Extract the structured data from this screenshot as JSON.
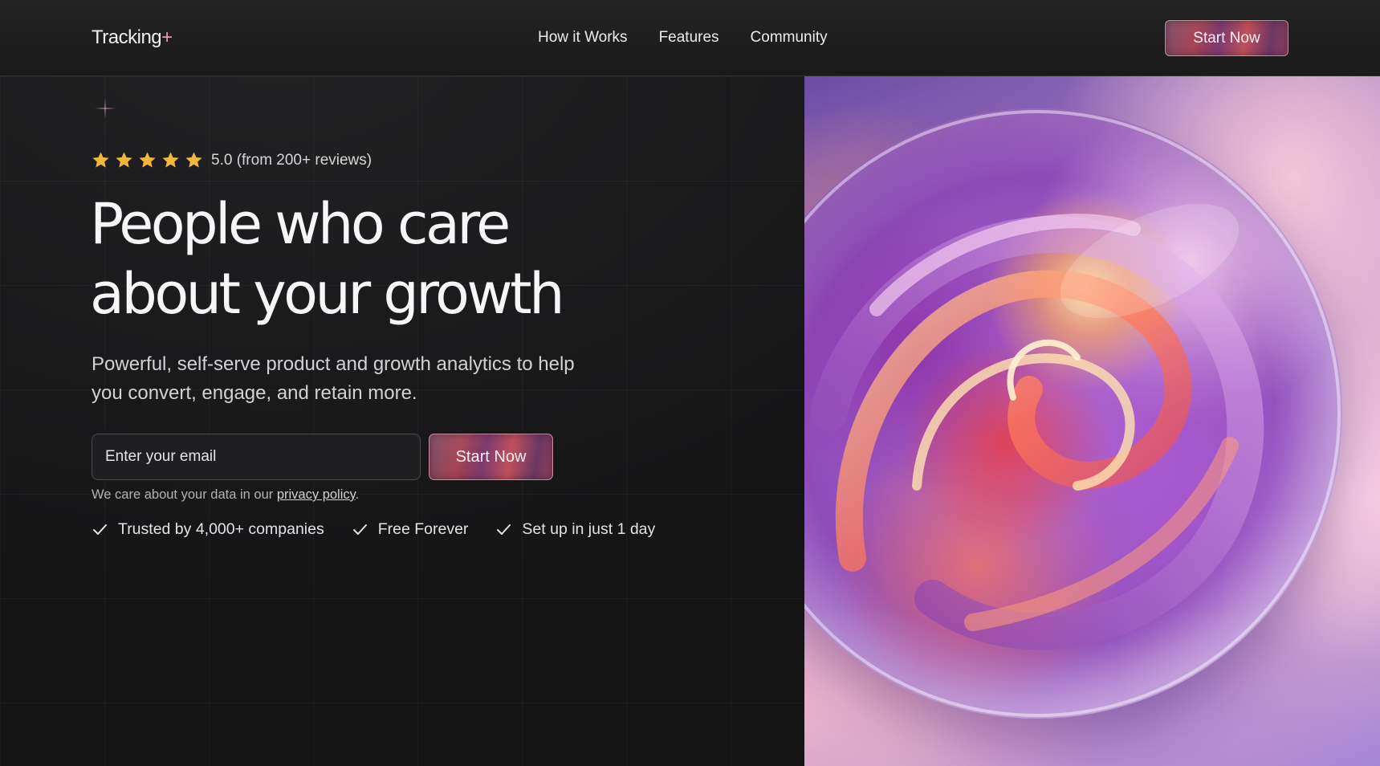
{
  "header": {
    "logo_text": "Tracking",
    "logo_plus": "+",
    "nav": [
      {
        "label": "How it Works"
      },
      {
        "label": "Features"
      },
      {
        "label": "Community"
      }
    ],
    "cta_label": "Start Now"
  },
  "hero": {
    "rating": {
      "stars": 5,
      "text": "5.0 (from 200+ reviews)",
      "star_color": "#f4b73e"
    },
    "headline_line1": "People who care",
    "headline_line2": "about your growth",
    "subtext": "Powerful, self-serve product and growth analytics to help you convert, engage, and retain more.",
    "form": {
      "email_placeholder": "Enter your email",
      "cta_label": "Start Now",
      "privacy_prefix": "We care about your data in our ",
      "privacy_link": "privacy policy",
      "privacy_suffix": "."
    },
    "checks": [
      {
        "label": "Trusted by 4,000+ companies"
      },
      {
        "label": "Free Forever"
      },
      {
        "label": "Set up in just 1 day"
      }
    ]
  },
  "icons": {
    "sparkle": "sparkle-icon",
    "star": "star-icon",
    "check": "check-icon"
  },
  "colors": {
    "background": "#151516",
    "accent_gradient_start": "#6a2f4e",
    "accent_gradient_end": "#c0505a",
    "text_primary": "#f7f5f7"
  }
}
